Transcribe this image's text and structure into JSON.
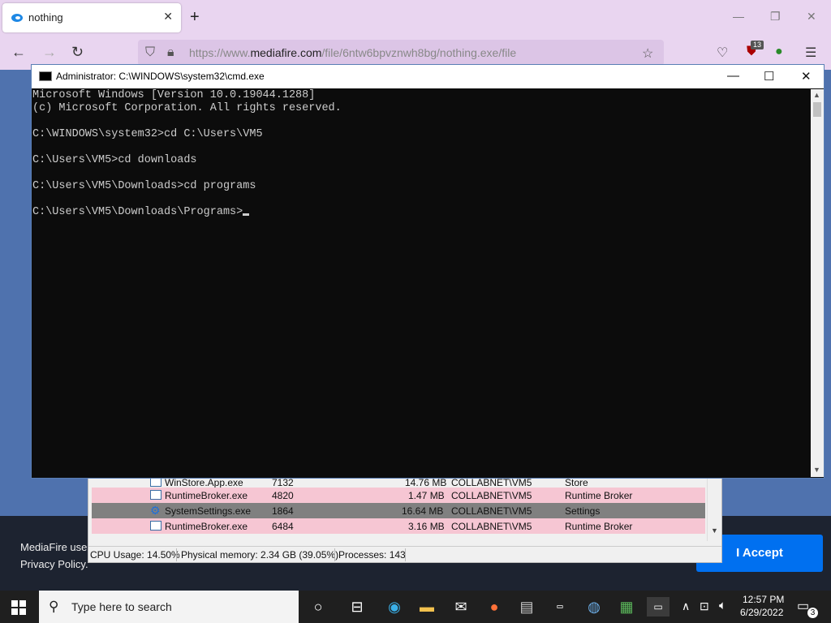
{
  "browser": {
    "tab_title": "nothing",
    "tab_close": "✕",
    "new_tab": "+",
    "url_prefix": "https://www.",
    "url_host": "mediafire.com",
    "url_path": "/file/6ntw6bpvznwh8bg/nothing.exe/file",
    "extension_badge": "13"
  },
  "page": {
    "cookie_text": "MediaFire use our Privacy Policy.",
    "accept_label": "I Accept"
  },
  "task_manager": {
    "rows": [
      {
        "name": "WinStore.App.exe",
        "pid": "7132",
        "memory": "14.76 MB",
        "user": "COLLABNET\\VM5",
        "description": "Store",
        "highlight": "none"
      },
      {
        "name": "RuntimeBroker.exe",
        "pid": "4820",
        "memory": "1.47 MB",
        "user": "COLLABNET\\VM5",
        "description": "Runtime Broker",
        "highlight": "pink"
      },
      {
        "name": "SystemSettings.exe",
        "pid": "1864",
        "memory": "16.64 MB",
        "user": "COLLABNET\\VM5",
        "description": "Settings",
        "highlight": "gray"
      },
      {
        "name": "RuntimeBroker.exe",
        "pid": "6484",
        "memory": "3.16 MB",
        "user": "COLLABNET\\VM5",
        "description": "Runtime Broker",
        "highlight": "pink"
      }
    ],
    "status": {
      "cpu": "CPU Usage: 14.50%",
      "memory": "Physical memory: 2.34 GB (39.05%)",
      "processes": "Processes: 143"
    }
  },
  "cmd": {
    "title": "Administrator: C:\\WINDOWS\\system32\\cmd.exe",
    "lines": [
      "Microsoft Windows [Version 10.0.19044.1288]",
      "(c) Microsoft Corporation. All rights reserved.",
      "",
      "C:\\WINDOWS\\system32>cd C:\\Users\\VM5",
      "",
      "C:\\Users\\VM5>cd downloads",
      "",
      "C:\\Users\\VM5\\Downloads>cd programs",
      "",
      "C:\\Users\\VM5\\Downloads\\Programs>"
    ]
  },
  "taskbar": {
    "search_placeholder": "Type here to search",
    "time": "12:57 PM",
    "date": "6/29/2022",
    "notification_count": "3"
  },
  "colors": {
    "tab_bar": "#e9d5f0",
    "cmd_bg": "#0c0c0c",
    "accept_button": "#0070f0",
    "row_pink": "#f6c6d3",
    "row_gray": "#808080"
  }
}
